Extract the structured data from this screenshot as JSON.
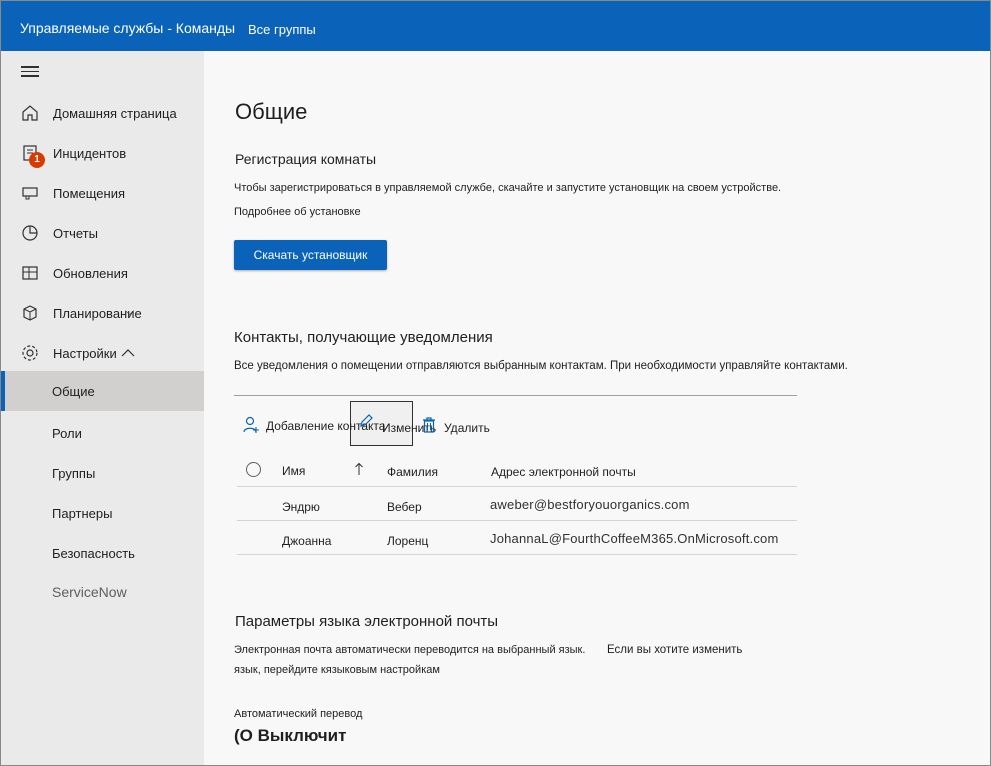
{
  "header": {
    "app_title": "Управляемые службы - Команды",
    "all_groups": "Все группы"
  },
  "sidebar": {
    "items": [
      {
        "label": "Домашняя страница",
        "icon": "home-icon"
      },
      {
        "label": "Инцидентов",
        "icon": "incidents-icon",
        "badge": "1"
      },
      {
        "label": "Помещения",
        "icon": "rooms-icon"
      },
      {
        "label": "Отчеты",
        "icon": "reports-icon"
      },
      {
        "label": "Обновления",
        "icon": "updates-icon"
      },
      {
        "label": "Планирование",
        "icon": "planning-icon"
      },
      {
        "label": "Настройки",
        "icon": "gear-icon"
      }
    ],
    "settings_children": [
      "Общие",
      "Роли",
      "Группы",
      "Партнеры",
      "Безопасность"
    ],
    "servicenow": "ServiceNow"
  },
  "main": {
    "title": "Общие",
    "registration": {
      "heading": "Регистрация комнаты",
      "description": "Чтобы зарегистрироваться в управляемой службе, скачайте и запустите установщик на своем устройстве.",
      "learn_more": "Подробнее об установке",
      "download_button": "Скачать установщик"
    },
    "contacts": {
      "heading": "Контакты, получающие уведомления",
      "description": "Все уведомления о помещении отправляются выбранным контактам. При необходимости управляйте контактами.",
      "add_contact": "Добавление контакта",
      "edit": "Изменить",
      "delete": "Удалить",
      "columns": {
        "first_name": "Имя",
        "last_name": "Фамилия",
        "email": "Адрес электронной почты"
      },
      "rows": [
        {
          "first_name": "Эндрю",
          "last_name": "Вебер",
          "email": "aweber@bestforyouorganics.com"
        },
        {
          "first_name": "Джоанна",
          "last_name": "Лоренц",
          "email": "JohannaL@FourthCoffeeM365.OnMicrosoft.com"
        }
      ]
    },
    "email_language": {
      "heading": "Параметры языка электронной почты",
      "line1a": "Электронная почта автоматически переводится на выбранный язык.",
      "line1b": "Если вы хотите изменить",
      "line2": "язык, перейдите кязыковым настройкам",
      "auto_translate_label": "Автоматический перевод",
      "toggle_text": "(О Выключит"
    }
  },
  "colors": {
    "brand": "#0a63b8",
    "badge": "#d83b01"
  }
}
